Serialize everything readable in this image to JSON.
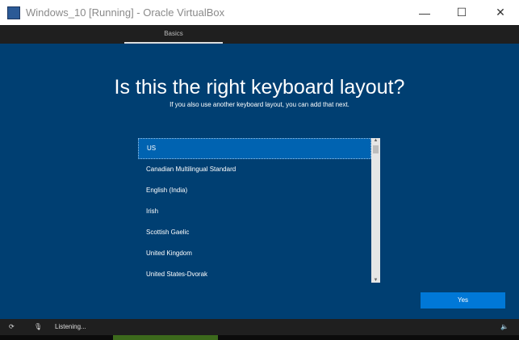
{
  "window": {
    "title": "Windows_10 [Running] - Oracle VirtualBox",
    "minimize": "—",
    "maximize": "☐",
    "close": "✕"
  },
  "tabs": [
    {
      "label": "Basics"
    }
  ],
  "main": {
    "heading": "Is this the right keyboard layout?",
    "subtitle": "If you also use another keyboard layout, you can add that next.",
    "layouts": [
      "US",
      "Canadian Multilingual Standard",
      "English (India)",
      "Irish",
      "Scottish Gaelic",
      "United Kingdom",
      "United States-Dvorak"
    ],
    "selected": "US",
    "yes_label": "Yes"
  },
  "statusbar": {
    "status": "Listening..."
  }
}
